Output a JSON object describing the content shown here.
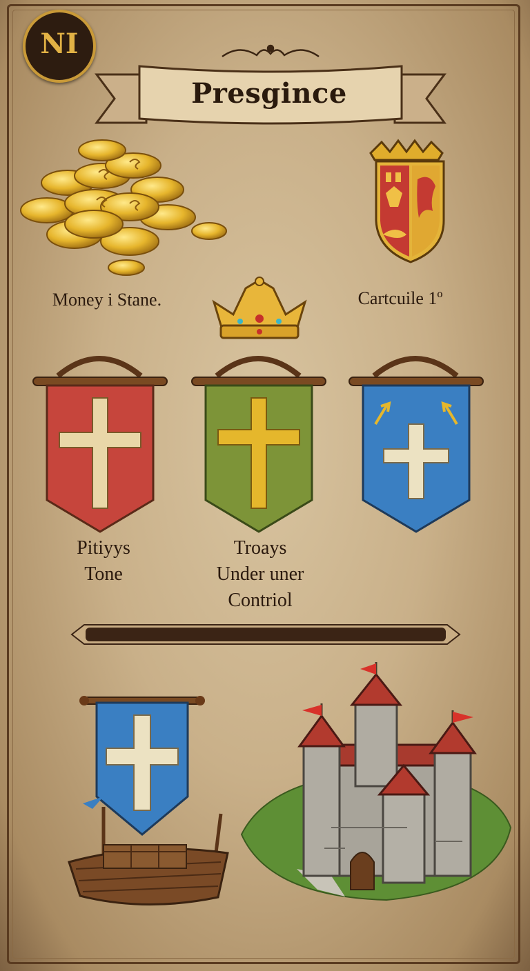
{
  "header": {
    "logo_text": "NI",
    "title": "Presgince"
  },
  "resources": {
    "money_label": "Money i Stane.",
    "crest_label": "Cartcuile  1º"
  },
  "banners": [
    {
      "label_lines": [
        "Pitiyys",
        "Tone"
      ],
      "color": "#c6453c",
      "cross_color": "#e9d7a8"
    },
    {
      "label_lines": [
        "Troays",
        "Under uner",
        "Contriol"
      ],
      "color": "#7d9438",
      "cross_color": "#e5b72c"
    },
    {
      "label_lines": [],
      "color": "#3a7fc2",
      "cross_color": "#ece2c2"
    }
  ],
  "icons": {
    "coins": "gold-coins-icon",
    "crown": "crown-icon",
    "crest": "heraldic-crest-icon",
    "ship": "ship-with-banner-icon",
    "castle": "castle-icon"
  },
  "colors": {
    "parchment": "#d8c4a0",
    "frame": "#5a3b20",
    "gold": "#e2b245",
    "divider": "#3b2415"
  }
}
